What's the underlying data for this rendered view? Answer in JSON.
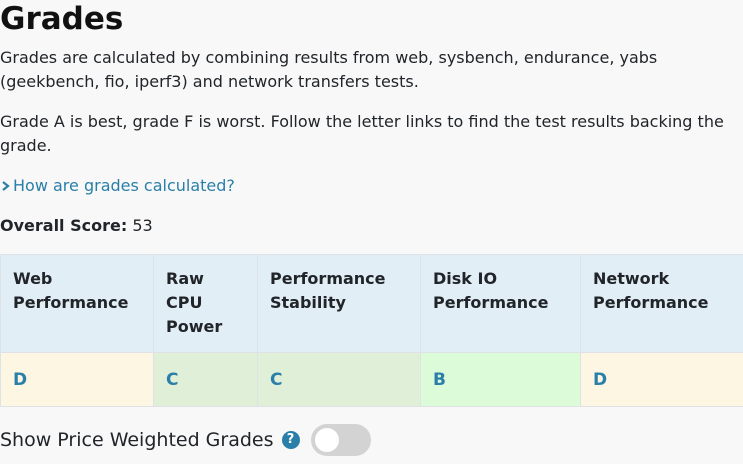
{
  "title": "Grades",
  "intro": "Grades are calculated by combining results from web, sysbench, endurance, yabs (geekbench, fio, iperf3) and network transfers tests.",
  "grade_note": "Grade A is best, grade F is worst. Follow the letter links to find the test results backing the grade.",
  "faq_link": "How are grades calculated?",
  "overall": {
    "label": "Overall Score:",
    "value": "53"
  },
  "table": {
    "headers": [
      "Web Performance",
      "Raw CPU Power",
      "Performance Stability",
      "Disk IO Performance",
      "Network Performance"
    ],
    "grades": [
      "D",
      "C",
      "C",
      "B",
      "D"
    ],
    "grade_colors": [
      "#fdf6e3",
      "#e0f0d8",
      "#e0f0d8",
      "#dcfcd9",
      "#fdf6e3"
    ]
  },
  "price_toggle": {
    "label": "Show Price Weighted Grades",
    "help_icon": "question-circle-icon",
    "help_glyph": "?",
    "enabled": false
  },
  "colors": {
    "link": "#2a7fa8",
    "header_bg": "#e2eef6",
    "toggle_off": "#d3d3d3"
  }
}
